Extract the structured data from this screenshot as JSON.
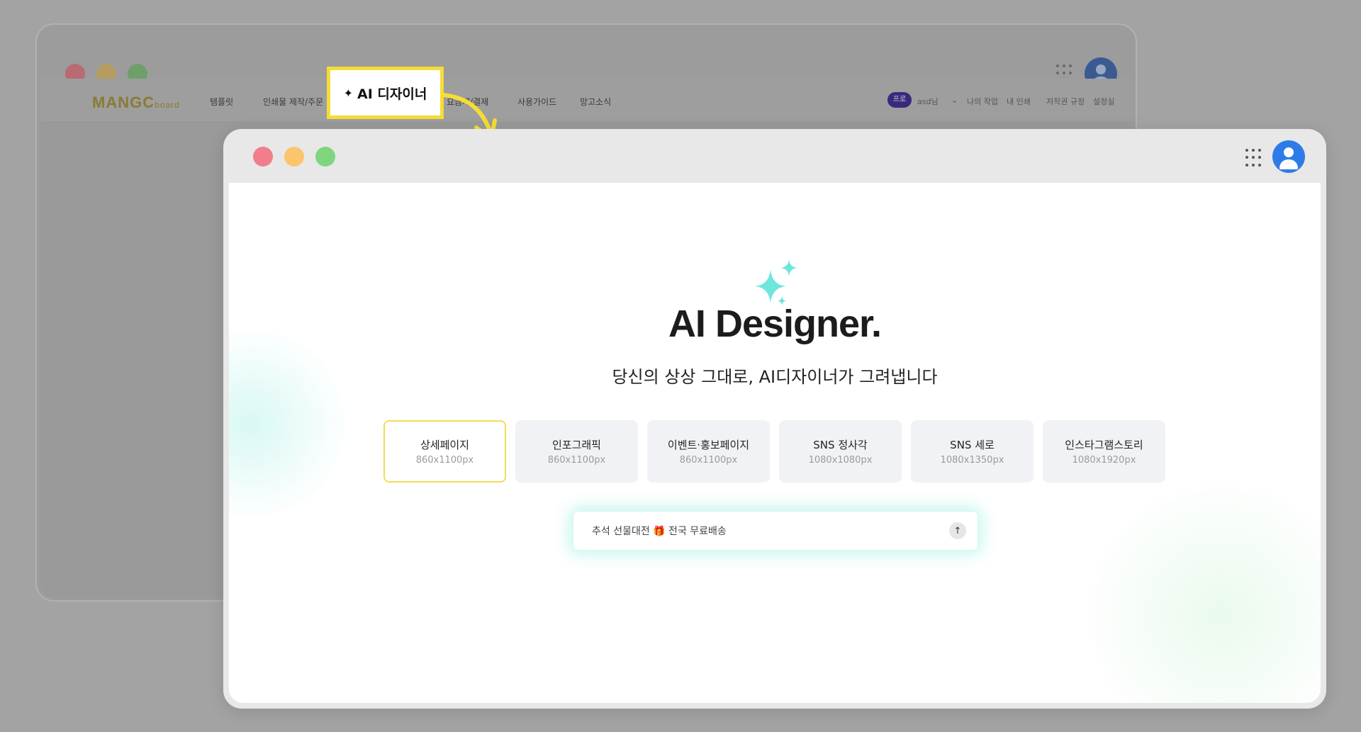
{
  "background_window": {
    "logo_main": "MANGC",
    "logo_suffix": "board",
    "nav": [
      "템플릿",
      "인쇄물 제작/주문",
      "요금제/결제",
      "사용가이드",
      "망고소식"
    ],
    "pro_badge": "프로",
    "user_name": "asd님",
    "user_menu": [
      "나의 작업",
      "내 인쇄",
      "저작권 규정",
      "설정실"
    ]
  },
  "callout": {
    "label": "AI 디자이너",
    "highlight_color": "#f5dd35"
  },
  "main": {
    "title": "AI Designer.",
    "subtitle": "당신의 상상 그대로, AI디자이너가 그려냅니다",
    "options": [
      {
        "name": "상세페이지",
        "size": "860x1100px",
        "selected": true
      },
      {
        "name": "인포그래픽",
        "size": "860x1100px",
        "selected": false
      },
      {
        "name": "이벤트·홍보페이지",
        "size": "860x1100px",
        "selected": false
      },
      {
        "name": "SNS 정사각",
        "size": "1080x1080px",
        "selected": false
      },
      {
        "name": "SNS 세로",
        "size": "1080x1350px",
        "selected": false
      },
      {
        "name": "인스타그램스토리",
        "size": "1080x1920px",
        "selected": false
      }
    ],
    "prompt": {
      "value": "추석 선물대전 🎁 전국 무료배송",
      "send_icon": "arrow-up-icon"
    }
  },
  "colors": {
    "sparkle": "#6ee6dc",
    "avatar": "#2d7be8",
    "selected_border": "#f2dd55",
    "pro_badge": "#3b2a7a"
  }
}
